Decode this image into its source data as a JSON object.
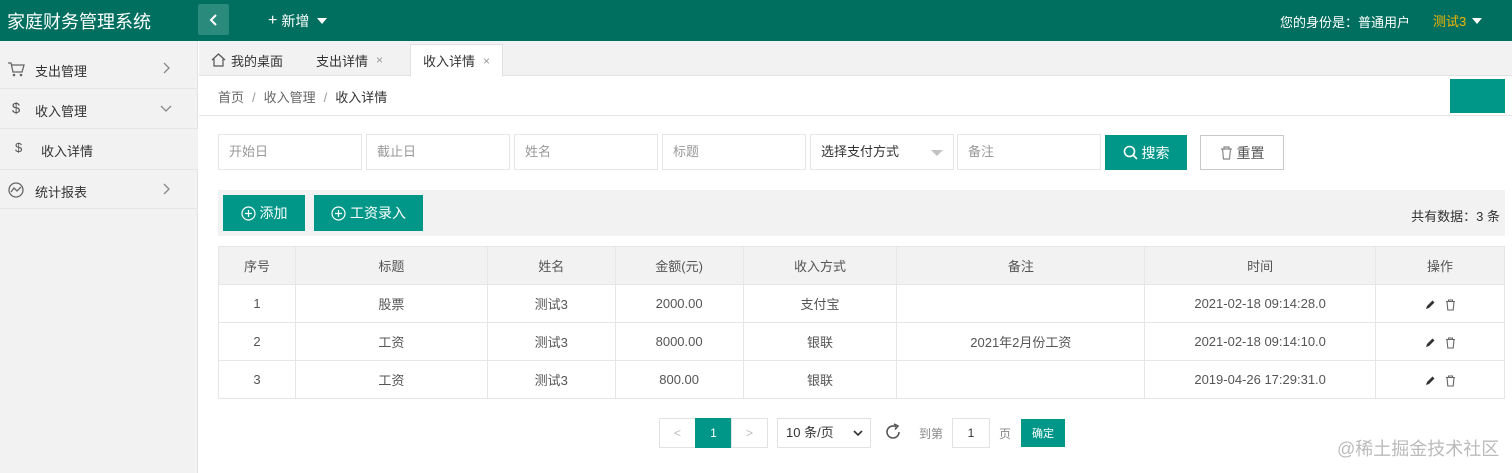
{
  "header": {
    "app_title": "家庭财务管理系统",
    "add_new": "新增",
    "identity": "您的身份是：普通用户",
    "username": "测试3",
    "colors": {
      "brand": "#006f5f",
      "accent": "#009688",
      "user": "#f5b400"
    }
  },
  "sidebar": {
    "items": [
      {
        "label": "支出管理",
        "icon": "cart-icon"
      },
      {
        "label": "收入管理",
        "icon": "dollar-icon"
      },
      {
        "label": "收入详情",
        "icon": "dollar-icon"
      },
      {
        "label": "统计报表",
        "icon": "chart-icon"
      }
    ]
  },
  "tabs": [
    {
      "label": "我的桌面",
      "icon": "home-icon"
    },
    {
      "label": "支出详情",
      "closable": "×"
    },
    {
      "label": "收入详情",
      "closable": "×",
      "active": true
    }
  ],
  "breadcrumb": [
    "首页",
    "收入管理",
    "收入详情"
  ],
  "filters": {
    "start_date": "开始日",
    "end_date": "截止日",
    "name": "姓名",
    "title": "标题",
    "pay_method": "选择支付方式",
    "remark": "备注",
    "search": "搜索",
    "reset": "重置"
  },
  "toolbar": {
    "add": "添加",
    "salary_entry": "工资录入",
    "total": "共有数据：3 条"
  },
  "table": {
    "headers": [
      "序号",
      "标题",
      "姓名",
      "金额(元)",
      "收入方式",
      "备注",
      "时间",
      "操作"
    ],
    "rows": [
      [
        "1",
        "股票",
        "测试3",
        "2000.00",
        "支付宝",
        "",
        "2021-02-18 09:14:28.0"
      ],
      [
        "2",
        "工资",
        "测试3",
        "8000.00",
        "银联",
        "2021年2月份工资",
        "2021-02-18 09:14:10.0"
      ],
      [
        "3",
        "工资",
        "测试3",
        "800.00",
        "银联",
        "",
        "2019-04-26 17:29:31.0"
      ]
    ]
  },
  "pagination": {
    "prev": "<",
    "current": "1",
    "next": ">",
    "page_size": "10 条/页",
    "goto_prefix": "到第",
    "goto_value": "1",
    "goto_suffix": "页",
    "confirm": "确定"
  },
  "watermark": "@稀土掘金技术社区"
}
